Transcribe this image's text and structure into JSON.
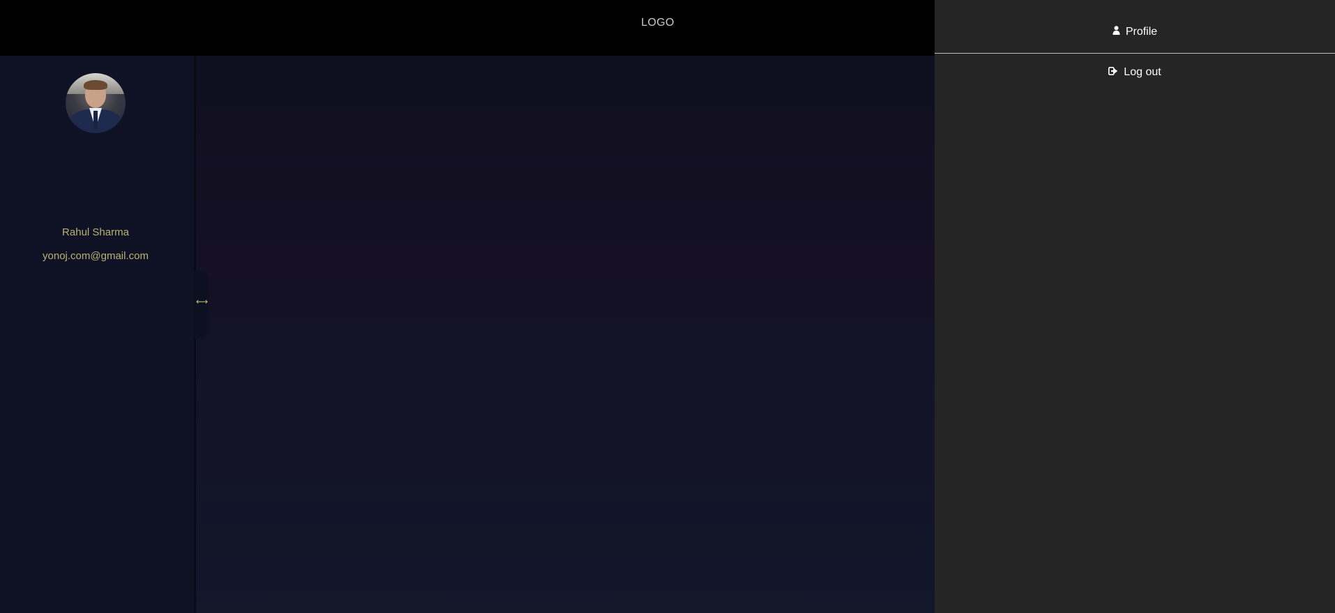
{
  "header": {
    "logo_text": "LOGO"
  },
  "sidebar": {
    "user": {
      "name": "Rahul Sharma",
      "email": "yonoj.com@gmail.com"
    },
    "resize_icon": "horizontal-resize-arrow-icon"
  },
  "user_menu": {
    "items": [
      {
        "label": "Profile",
        "icon": "user-icon"
      },
      {
        "label": "Log out",
        "icon": "logout-icon"
      }
    ]
  },
  "colors": {
    "accent_text": "#b9b371",
    "header_bg": "#000000",
    "panel_bg": "#252525",
    "sidebar_bg": "#0e1224"
  }
}
